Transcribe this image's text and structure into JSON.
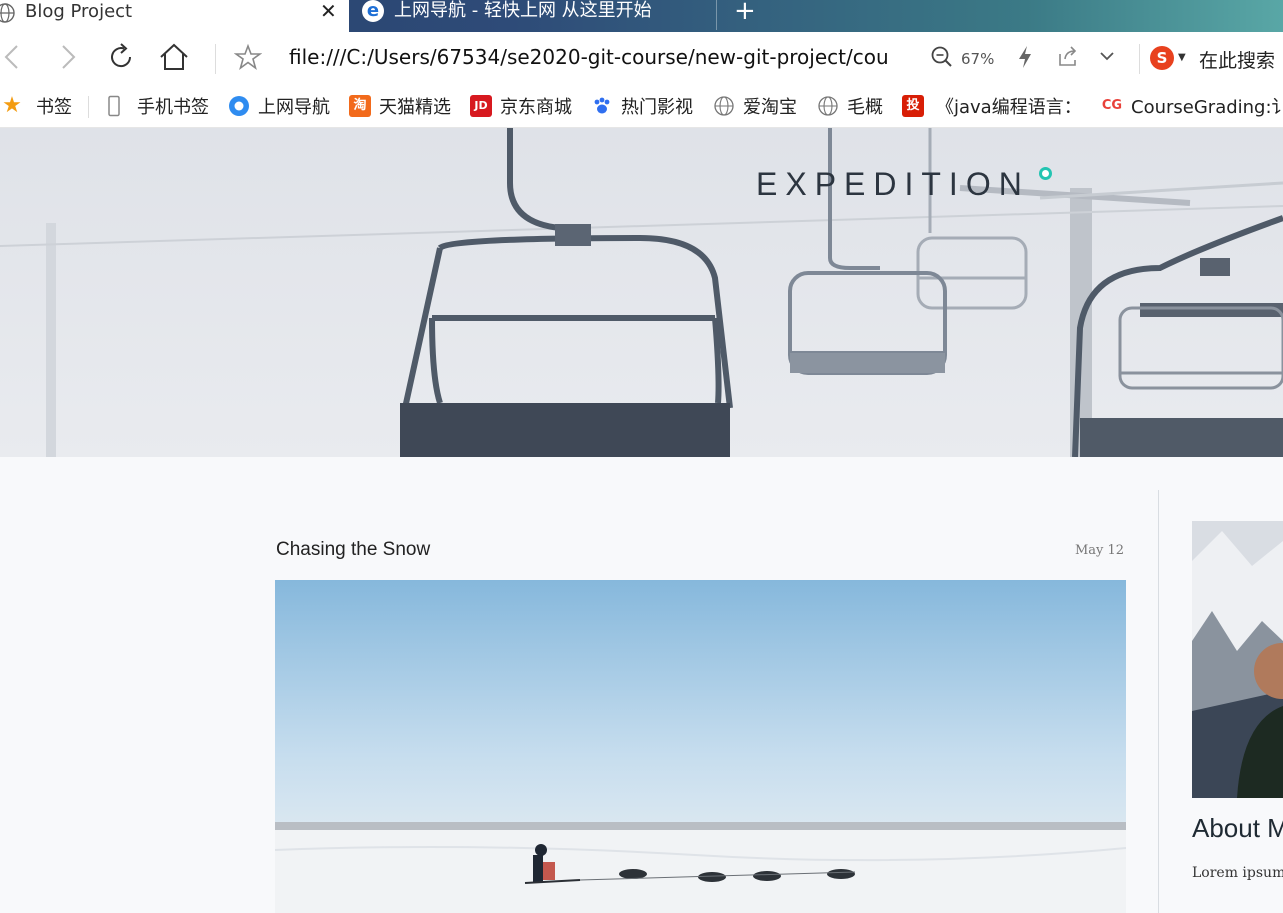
{
  "tabs": [
    {
      "title": "Blog Project",
      "close": "✕",
      "icon": "globe-icon"
    },
    {
      "title": "上网导航 - 轻快上网 从这里开始",
      "icon": "ie-icon",
      "icon_glyph": "e"
    }
  ],
  "new_tab_label": "+",
  "toolbar": {
    "url": "file:///C:/Users/67534/se2020-git-course/new-git-project/cou",
    "zoom": "67%",
    "search_engine_glyph": "S",
    "search_label": "在此搜索"
  },
  "bookmarks": [
    {
      "label": "书签",
      "icon": "star-icon"
    },
    {
      "label": "手机书签",
      "icon": "phone-icon"
    },
    {
      "label": "上网导航",
      "icon": "nav-icon"
    },
    {
      "label": "天猫精选",
      "icon": "taobao-icon",
      "glyph": "淘"
    },
    {
      "label": "京东商城",
      "icon": "jd-icon",
      "glyph": "JD"
    },
    {
      "label": "热门影视",
      "icon": "paw-icon"
    },
    {
      "label": "爱淘宝",
      "icon": "globe-icon"
    },
    {
      "label": "毛概",
      "icon": "globe-icon"
    },
    {
      "label": "《java编程语言：",
      "icon": "red-book-icon",
      "glyph": "投"
    },
    {
      "label": "CourseGrading:讠",
      "icon": "cg-icon",
      "glyph": "CG"
    }
  ],
  "site": {
    "brand": "EXPEDITION",
    "brand_accent": "#23c4b2"
  },
  "post": {
    "title": "Chasing the Snow",
    "date": "May 12"
  },
  "sidebar": {
    "about_title": "About M",
    "about_text": "Lorem ipsum adipisicing el"
  }
}
